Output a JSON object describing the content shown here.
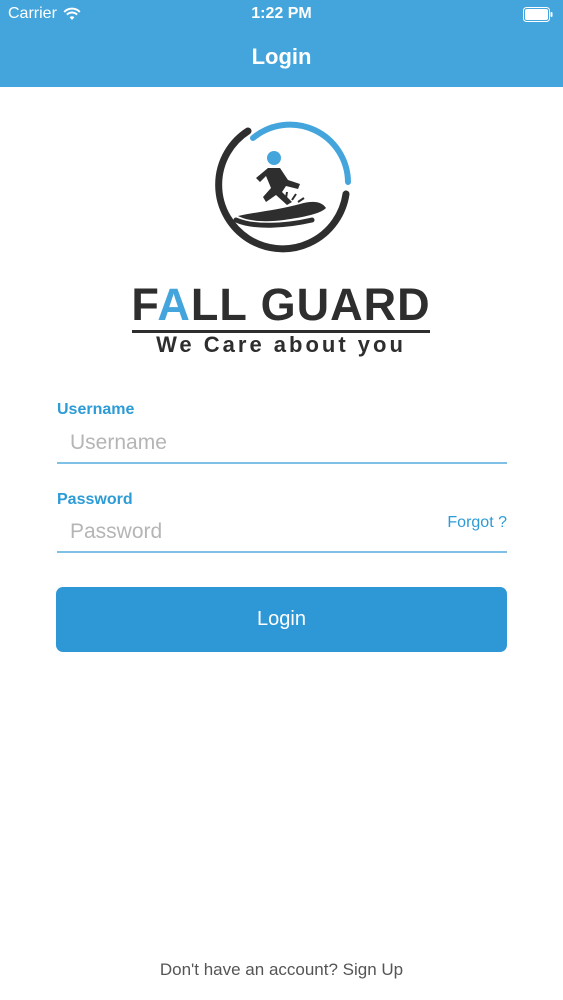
{
  "status_bar": {
    "carrier": "Carrier",
    "time": "1:22 PM",
    "wifi_icon": "wifi-icon",
    "battery_icon": "battery-icon"
  },
  "nav": {
    "title": "Login"
  },
  "logo": {
    "emblem_icon": "fall-guard-emblem-icon",
    "brand_prefix": "F",
    "brand_accent": "A",
    "brand_suffix": "LL GUARD",
    "tagline": "We Care about you"
  },
  "form": {
    "username": {
      "label": "Username",
      "placeholder": "Username",
      "value": ""
    },
    "password": {
      "label": "Password",
      "placeholder": "Password",
      "value": ""
    },
    "forgot_label": "Forgot ?",
    "login_label": "Login"
  },
  "footer": {
    "signup_text": "Don't have an account? Sign Up"
  },
  "colors": {
    "header_blue": "#44a5dc",
    "button_blue": "#2e98d6",
    "label_blue": "#2d9bd5",
    "brand_dark": "#2e2e2e"
  }
}
